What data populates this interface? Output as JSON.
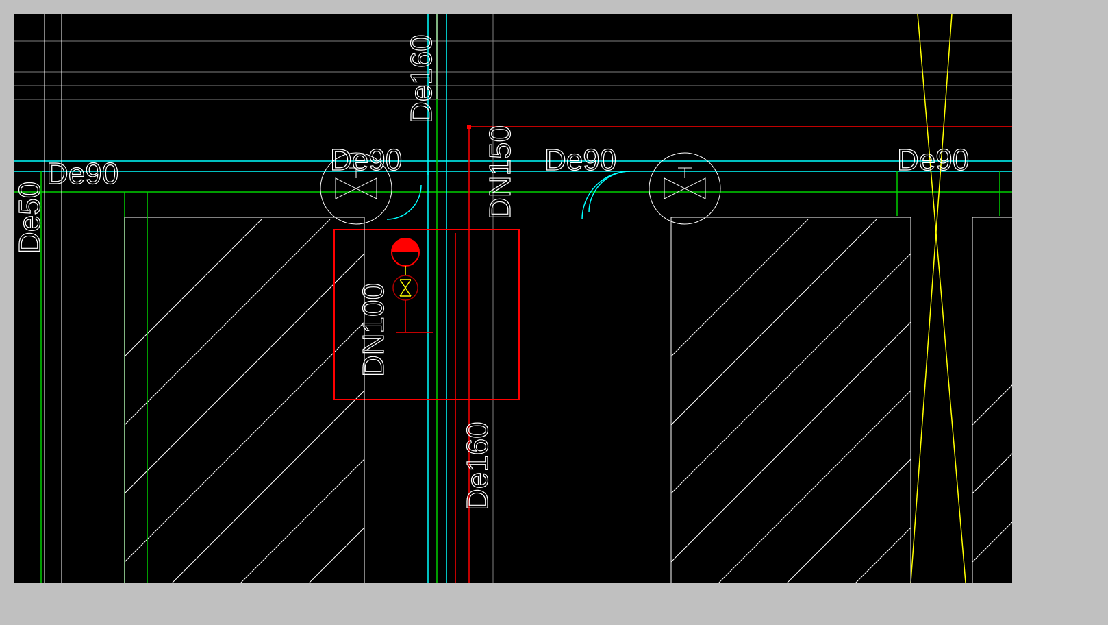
{
  "labels": {
    "de90_1": "De90",
    "de90_2": "De90",
    "de90_3": "De90",
    "de90_4": "De90",
    "de50": "De50",
    "de160_top": "De160",
    "de160_bot": "De160",
    "dn150": "DN150",
    "dn100": "DN100"
  },
  "colors": {
    "cyan": "#00ffff",
    "green": "#00d000",
    "red": "#ff0000",
    "yellow": "#ffff00",
    "white": "#ffffff",
    "gray": "#808080"
  },
  "symbols": {
    "valve1": "gate-valve",
    "valve2": "gate-valve",
    "valve_small": "gate-valve-small",
    "hydrant": "fire-hydrant"
  }
}
